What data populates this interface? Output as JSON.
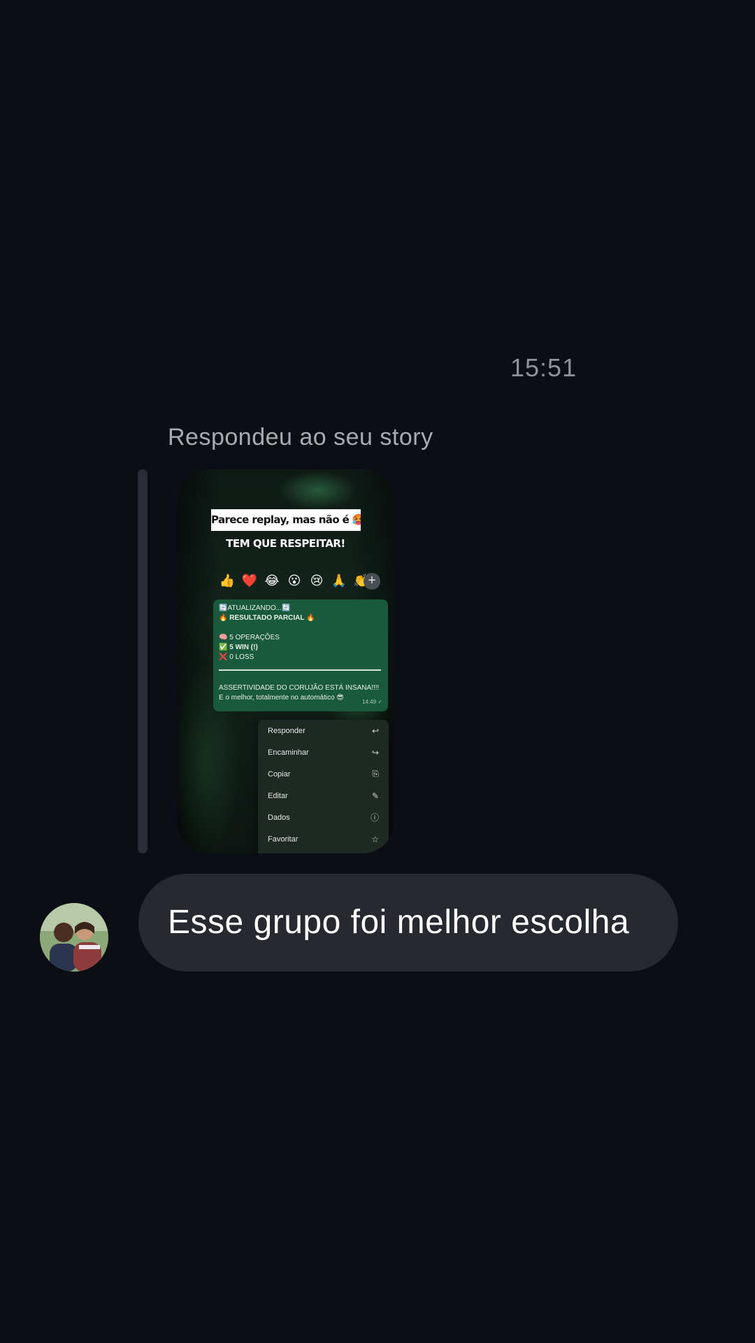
{
  "timestamp": "15:51",
  "reply_label": "Respondeu ao seu story",
  "story": {
    "headline": "Parece replay, mas não é 🥵",
    "subheadline": "TEM QUE RESPEITAR!",
    "reactions": [
      "👍",
      "❤️",
      "😂",
      "😮",
      "😢",
      "🙏",
      "👏"
    ],
    "reaction_more": "+",
    "message": {
      "line1": "🔄ATUALIZANDO...🔄",
      "line2": "🔥 RESULTADO PARCIAL 🔥",
      "line3": "🧠 5 OPERAÇÕES",
      "line4": "✅ 5 WIN (!)",
      "line5": "❌ 0 LOSS",
      "line6": "ASSERTIVIDADE DO CORUJÃO ESTÁ INSANA!!!!",
      "line7": "E o melhor, totalmente no automático 😎",
      "time": "14:49 ✓"
    },
    "menu": [
      {
        "label": "Responder",
        "icon": "↩"
      },
      {
        "label": "Encaminhar",
        "icon": "↪"
      },
      {
        "label": "Copiar",
        "icon": "⎘"
      },
      {
        "label": "Editar",
        "icon": "✎"
      },
      {
        "label": "Dados",
        "icon": "ⓘ"
      },
      {
        "label": "Favoritar",
        "icon": "☆"
      }
    ]
  },
  "message": {
    "text": "Esse grupo foi melhor escolha"
  }
}
